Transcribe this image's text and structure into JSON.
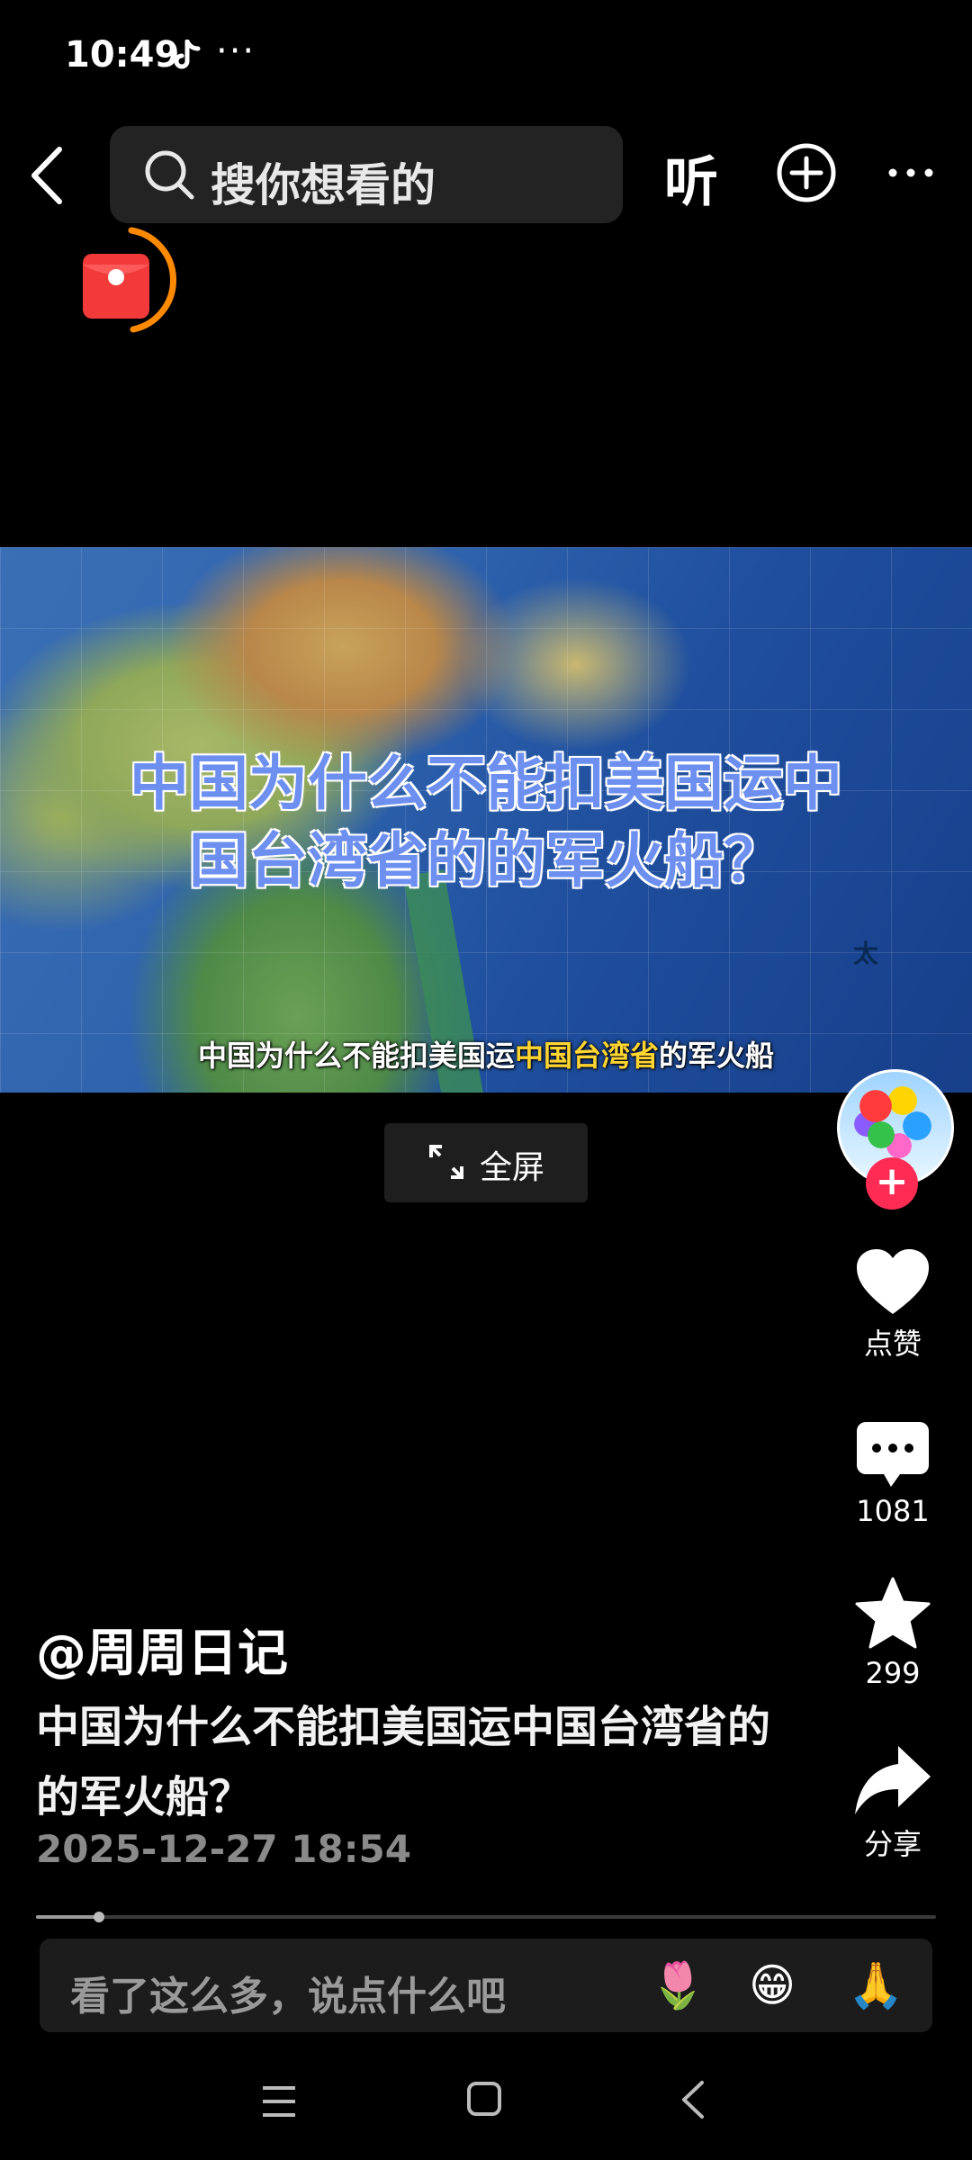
{
  "status_bar": {
    "time": "10:49",
    "more": "···"
  },
  "top_bar": {
    "search_placeholder": "搜你想看的",
    "listen_label": "听"
  },
  "video": {
    "overlay_title_line1": "中国为什么不能扣美国运中",
    "overlay_title_line2": "国台湾省的的军火船？",
    "map_label": "太",
    "subtitle_plain": "中国为什么不能扣美国运",
    "subtitle_highlight": "中国台湾省",
    "subtitle_end": "的军火船"
  },
  "fullscreen_label": "全屏",
  "actions": {
    "like_label": "点赞",
    "comment_count": "1081",
    "favorite_count": "299",
    "share_label": "分享"
  },
  "post": {
    "author": "@周周日记",
    "caption": "中国为什么不能扣美国运中国台湾省的的军火船？",
    "publish_time": "2025-12-27 18:54"
  },
  "playback": {
    "progress": 0.07
  },
  "comment_bar": {
    "placeholder": "看了这么多，说点什么吧",
    "emojis": [
      "🌷",
      "😁",
      "🙏"
    ]
  },
  "colors": {
    "accent": "#fe2c55",
    "ring": "#ff8a00",
    "highlight": "#ffd531"
  }
}
